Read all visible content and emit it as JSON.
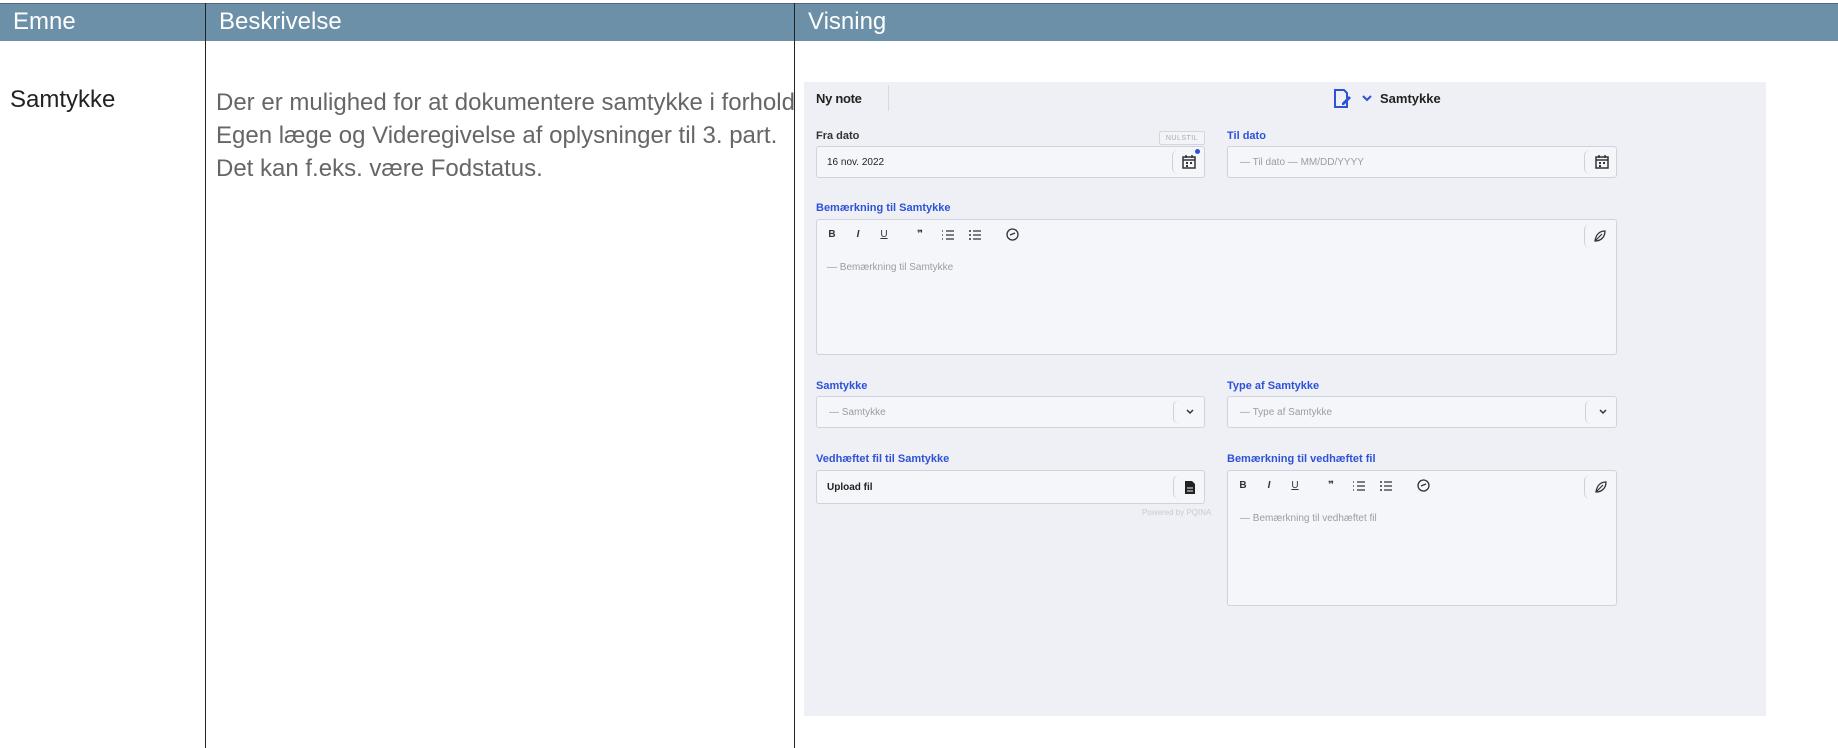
{
  "table": {
    "headers": [
      "Emne",
      "Beskrivelse",
      "Visning"
    ],
    "row": {
      "topic": "Samtykke",
      "description": "Der er mulighed for at dokumentere samtykke i forhold Egen læge og Videregivelse af oplysninger til 3. part. Det kan f.eks. være Fodstatus."
    }
  },
  "screenshot": {
    "top_left": "Ny note",
    "form_title": "Samtykke",
    "fra_dato": {
      "label": "Fra dato",
      "value": "16 nov. 2022",
      "reset": "NULSTIL"
    },
    "til_dato": {
      "label": "Til dato",
      "placeholder": "— Til dato — MM/DD/YYYY"
    },
    "bemaerkning": {
      "label": "Bemærkning til Samtykke",
      "placeholder": "— Bemærkning til Samtykke"
    },
    "samtykke": {
      "label": "Samtykke",
      "placeholder": "— Samtykke"
    },
    "type": {
      "label": "Type af Samtykke",
      "placeholder": "— Type af Samtykke"
    },
    "vedhaeftet": {
      "label": "Vedhæftet fil til Samtykke",
      "value": "Upload fil",
      "powered": "Powered by PQINA"
    },
    "bem_vedhaeftet": {
      "label": "Bemærkning til vedhæftet fil",
      "placeholder": "— Bemærkning til vedhæftet fil"
    },
    "toolbar": {
      "bold": "B",
      "italic": "I",
      "underline": "U",
      "quote": "❞"
    }
  },
  "colors": {
    "header_bg": "#6b90a8",
    "accent": "#2d52d8",
    "panel_bg": "#eff0f5"
  }
}
